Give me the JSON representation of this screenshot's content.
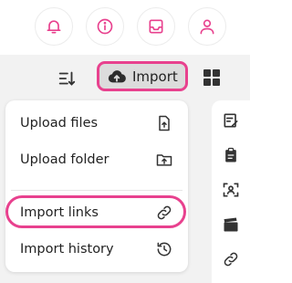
{
  "header": {
    "icons": [
      "bell-icon",
      "info-icon",
      "inbox-icon",
      "user-icon"
    ],
    "accent_color": "#e8418e"
  },
  "toolbar": {
    "import_label": "Import",
    "icons": [
      "sort-icon",
      "cloud-upload-icon",
      "grid-view-icon"
    ]
  },
  "menu": {
    "items": [
      {
        "label": "Upload files",
        "icon": "upload-file-icon"
      },
      {
        "label": "Upload folder",
        "icon": "upload-folder-icon"
      },
      {
        "label": "Import links",
        "icon": "link-icon",
        "highlighted": true
      },
      {
        "label": "Import history",
        "icon": "history-icon"
      }
    ]
  },
  "side_rail": {
    "icons": [
      "edit-note-icon",
      "clipboard-icon",
      "face-scan-icon",
      "clapperboard-icon",
      "link-icon"
    ]
  }
}
